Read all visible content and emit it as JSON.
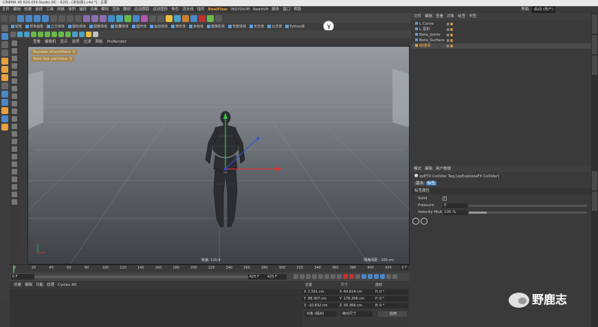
{
  "app": {
    "title": "CINEMA 4D R20.059 Studio (RC - R20) - [未标题1.c4d *] - 主要",
    "layout_label": "界面:",
    "layout_value": "启动 (用户)"
  },
  "menu": [
    "文件",
    "编辑",
    "创建",
    "选择",
    "工具",
    "网格",
    "体积",
    "捕捉",
    "动画",
    "模拟",
    "渲染",
    "雕刻",
    "运动跟踪",
    "运动图形",
    "角色",
    "流水线",
    "插件",
    "RealFlow",
    "INSYDIUM",
    "Redshift",
    "脚本",
    "窗口",
    "帮助"
  ],
  "menu_accent": [
    "RealFlow"
  ],
  "toolbar2": [
    "铅笔",
    "样条画笔",
    "立方体体",
    "圆柱体体",
    "圆锥体体",
    "胶囊体体",
    "圆环体",
    "运动体体",
    "地形体",
    "目标体",
    "摄像机体",
    "背景体体",
    "天空体",
    "公式体",
    "Python体"
  ],
  "viewport": {
    "menu": [
      "查看",
      "摄像机",
      "显示",
      "选项",
      "过滤",
      "面板",
      "ProRender"
    ],
    "hud": [
      "Number of emitters: 0",
      "Total live particles: 0"
    ],
    "speed_label": "帧速: 115.4",
    "grid_label": "网格间距 : 100 cm"
  },
  "timeline": {
    "ticks": [
      "0",
      "20",
      "40",
      "60",
      "80",
      "100",
      "120",
      "140",
      "160",
      "180",
      "200",
      "220",
      "240",
      "260",
      "280",
      "300",
      "320",
      "340",
      "360",
      "380",
      "400",
      "420"
    ],
    "end_frame": "0 F",
    "current": "0 F",
    "field_start": "0 F",
    "field_max": "425 F",
    "field_end": "425 F"
  },
  "material_menu": [
    "创建",
    "编辑",
    "功能",
    "纹理",
    "Cycles 4D"
  ],
  "coords": {
    "headers": [
      "位置",
      "尺寸",
      "旋转"
    ],
    "rows": [
      {
        "axis": "X",
        "pos": "2.551 cm",
        "size": "64.614 cm",
        "rot_axis": "H",
        "rot": "0 °"
      },
      {
        "axis": "Y",
        "pos": "88.307 cm",
        "size": "176.306 cm",
        "rot_axis": "P",
        "rot": "0 °"
      },
      {
        "axis": "Z",
        "pos": "-10.832 cm",
        "size": "50.366 cm",
        "rot_axis": "B",
        "rot": "0 °"
      }
    ],
    "mode1": "对象 (相对)",
    "mode2": "绝对尺寸",
    "apply": "应用"
  },
  "objects": {
    "menu": [
      "文件",
      "编辑",
      "查看",
      "对象",
      "标签",
      "书签"
    ],
    "items": [
      "L Curve",
      "L 变形",
      "Beta_Joints",
      "Beta_Surface",
      "碰撞体"
    ]
  },
  "attributes": {
    "menu": [
      "模式",
      "编辑",
      "用户数据"
    ],
    "tag_title": "xpETX Collider Tag [xpExplosiaFX Collider]",
    "tabs": [
      "基本",
      "标签"
    ],
    "section": "标签属性",
    "solid_label": "Solid",
    "pressure_label": "Pressure",
    "pressure_value": "0",
    "velocity_label": "Velocity Mult",
    "velocity_value": "100 %"
  },
  "watermark": "野鹿志",
  "colors": {
    "hud_bg": "#b4781480",
    "accent": "#e6a23c",
    "axis_x": "#e03030",
    "axis_y": "#30d040",
    "axis_z": "#3050e0"
  },
  "percent": {
    "velocity_fill": 0.15
  }
}
